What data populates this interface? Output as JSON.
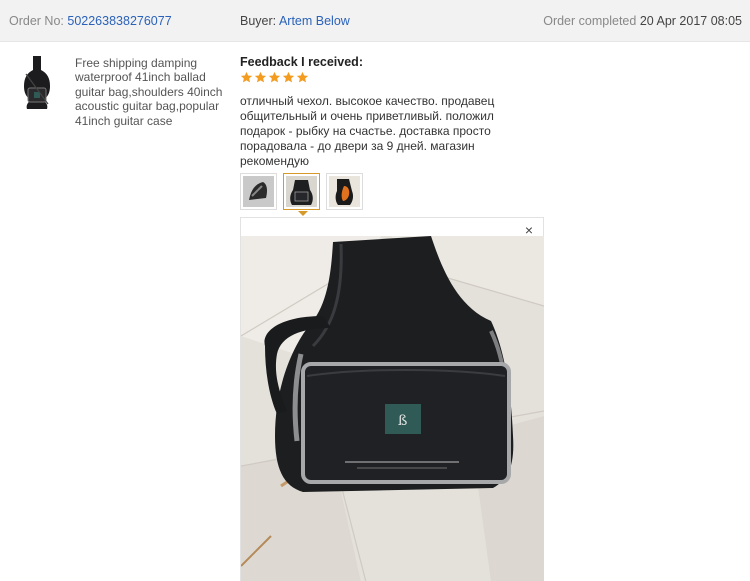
{
  "order": {
    "no_label": "Order No:",
    "no_value": "502263838276077",
    "buyer_label": "Buyer:",
    "buyer_value": "Artem Below",
    "status_label": "Order completed",
    "status_date": "20 Apr 2017 08:05"
  },
  "product": {
    "title": "Free shipping damping waterproof 41inch ballad guitar bag,shoulders 40inch acoustic guitar bag,popular 41inch guitar case",
    "thumbnail_icon": "guitar-bag-image"
  },
  "feedback": {
    "heading": "Feedback I received:",
    "rating": 5,
    "rating_max": 5,
    "star_color": "#f39c1f",
    "text": "отличный чехол. высокое качество. продавец общительный и очень приветливый. положил подарок - рыбку на счастье. доставка просто порадовала - до двери за 9 дней. магазин рекомендую"
  },
  "photos": {
    "count": 3,
    "selected_index": 2,
    "accent_color": "#d59a2a"
  },
  "viewer": {
    "close_symbol": "×"
  },
  "colors": {
    "link": "#2b62b9",
    "header_bg": "#f2f2f2"
  }
}
